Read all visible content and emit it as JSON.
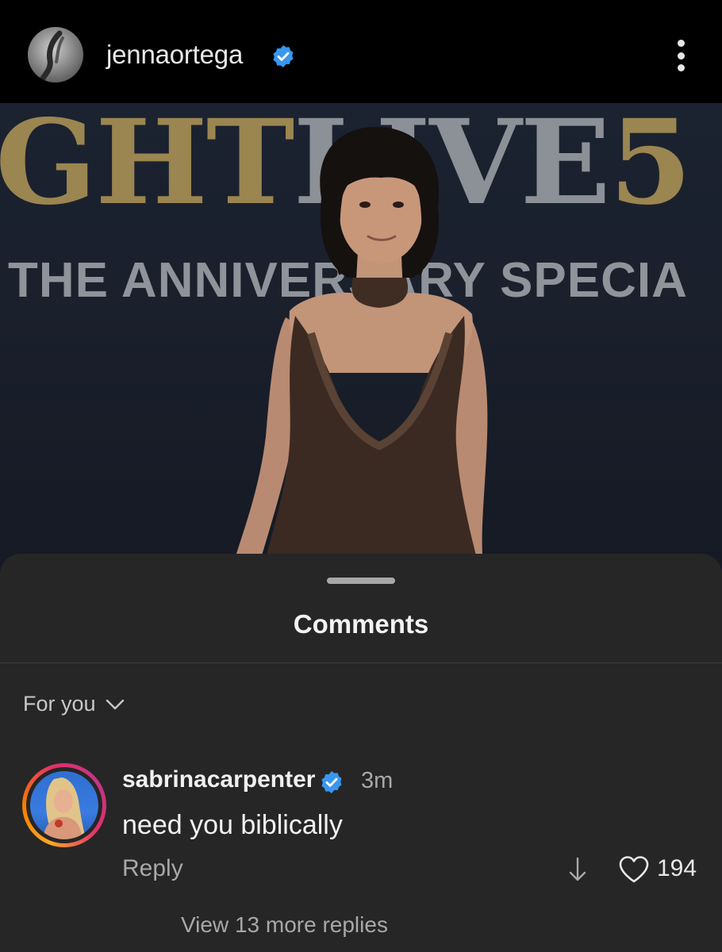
{
  "header": {
    "username": "jennaortega",
    "verified": true,
    "avatar_icon": "profile-avatar",
    "more_icon": "more-vertical-icon"
  },
  "photo": {
    "backdrop_line1_gold": "GHT",
    "backdrop_line1_silver": "LIVE",
    "backdrop_line1_tail": "5",
    "backdrop_line2": "THE ANNIVERSARY SPECIA"
  },
  "sheet": {
    "title": "Comments",
    "sort_label": "For you"
  },
  "comment": {
    "username": "sabrinacarpenter",
    "verified": true,
    "time": "3m",
    "text": "need you biblically",
    "reply_label": "Reply",
    "likes": "194",
    "view_replies": "View 13 more replies"
  },
  "colors": {
    "background": "#000000",
    "sheet": "#262626",
    "verified_blue": "#3897f0",
    "muted_text": "#a8a8a8"
  }
}
